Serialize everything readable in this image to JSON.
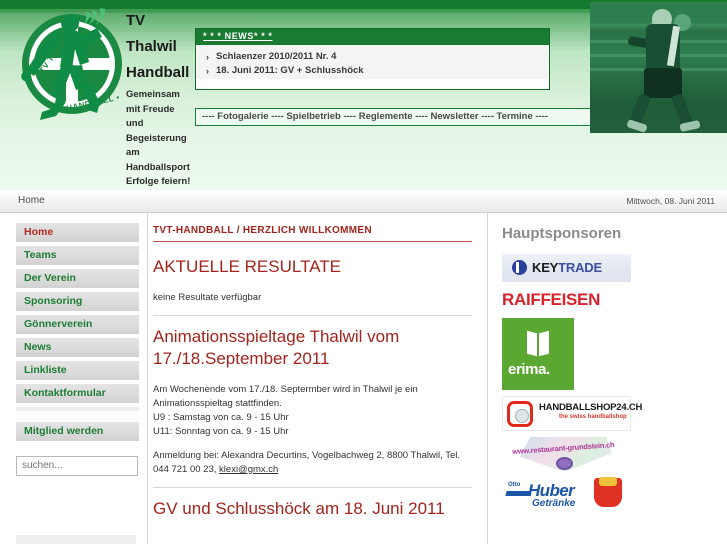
{
  "header": {
    "club_name_lines": [
      "TV",
      "Thalwil",
      "Handball"
    ],
    "motto": "Gemeinsam mit Freude und Begeisterung am Handballsport Erfolge feiern!",
    "logo": {
      "text_top": "TV THALWIL",
      "text_bottom": "• HANDBALL •"
    },
    "news": {
      "title": "* * * NEWS* * *",
      "items": [
        "Schlaenzer 2010/2011 Nr. 4",
        "18. Juni 2011: GV + Schlusshöck"
      ],
      "bullet": "›"
    },
    "topnav": {
      "text": "---- Fotogalerie ---- Spielbetrieb ---- Reglemente ---- Newsletter ---- Termine ----",
      "items": [
        "Fotogalerie",
        "Spielbetrieb",
        "Reglemente",
        "Newsletter",
        "Termine"
      ]
    },
    "photo_alt": "Handballspieler Foto"
  },
  "crumbbar": {
    "breadcrumb": "Home",
    "date": "Mittwoch, 08. Juni 2011"
  },
  "sidebar": {
    "items": [
      {
        "label": "Home",
        "active": true
      },
      {
        "label": "Teams",
        "active": false
      },
      {
        "label": "Der Verein",
        "active": false
      },
      {
        "label": "Sponsoring",
        "active": false
      },
      {
        "label": "Gönnerverein",
        "active": false
      },
      {
        "label": "News",
        "active": false
      },
      {
        "label": "Linkliste",
        "active": false
      },
      {
        "label": "Kontaktformular",
        "active": false
      }
    ],
    "member_item": "Mitglied werden",
    "search_placeholder": "suchen...",
    "search_value": ""
  },
  "main": {
    "kicker": "TVT-HANDBALL / HERZLICH WILLKOMMEN",
    "articles": [
      {
        "title": "AKTUELLE RESULTATE",
        "body": "keine Resultate verfügbar"
      },
      {
        "title": "Animationsspieltage Thalwil vom 17./18.September 2011",
        "body_lines": [
          "Am Wochenende vom 17./18. Septermber wird in Thalwil je ein",
          "Animationsspieltag stattfinden.",
          "U9 :  Samstag von ca. 9 - 15 Uhr",
          "U11: Sonntag von ca. 9 - 15 Uhr"
        ],
        "contact_prefix": "Anmeldung bei: Alexandra Decurtins, Vogelbachweg 2, 8800 Thalwil, Tel. 044 721 00 23,",
        "contact_email": "klexi@gmx.ch"
      },
      {
        "title": "GV und Schlusshöck am 18. Juni 2011"
      }
    ]
  },
  "sponsors": {
    "title": "Hauptsponsoren",
    "logos": [
      {
        "name": "keytrade",
        "text_a": "KEY",
        "text_b": "TRADE"
      },
      {
        "name": "raiffeisen",
        "text": "RAIFFEISEN"
      },
      {
        "name": "erima",
        "text": "erima."
      },
      {
        "name": "handballshop24",
        "text": "HANDBALLSHOP24.CH",
        "sub": "the swiss handballshop"
      },
      {
        "name": "restaurant-grundstein",
        "text": "www.restaurant-grundstein.ch"
      },
      {
        "name": "huber-getraenke",
        "text_small": "Otto",
        "text": "Huber",
        "text2": "Getränke"
      }
    ]
  },
  "colors": {
    "brand_green": "#1a7a31",
    "accent_red": "#a3241c",
    "link_green": "#1d7d35",
    "active_red": "#b02b22"
  }
}
